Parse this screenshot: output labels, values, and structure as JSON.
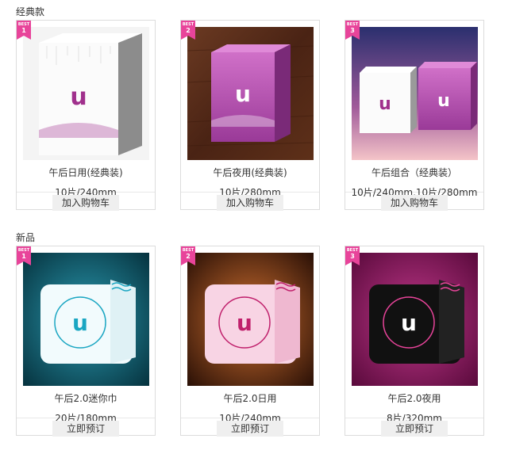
{
  "sections": [
    {
      "title": "经典款",
      "products": [
        {
          "badge_label": "BEST",
          "rank": "1",
          "name": "午后日用(经典装)",
          "spec": "10片/240mm",
          "action": "加入购物车",
          "bg": "#f3f3f3",
          "box": "white"
        },
        {
          "badge_label": "BEST",
          "rank": "2",
          "name": "午后夜用(经典装)",
          "spec": "10片/280mm",
          "action": "加入购物车",
          "bg": "#5a2e1c",
          "box": "purple"
        },
        {
          "badge_label": "BEST",
          "rank": "3",
          "name": "午后组合（经典装）",
          "spec": "10片/240mm,10片/280mm",
          "action": "加入购物车",
          "bg": "#6a4a90",
          "box": "combo"
        }
      ]
    },
    {
      "title": "新品",
      "products": [
        {
          "badge_label": "BEST",
          "rank": "1",
          "name": "午后2.0迷你巾",
          "spec": "20片/180mm",
          "action": "立即预订",
          "bg": "#0f5d70",
          "box": "white-pack"
        },
        {
          "badge_label": "BEST",
          "rank": "2",
          "name": "午后2.0日用",
          "spec": "10片/240mm",
          "action": "立即预订",
          "bg": "#6a2c0c",
          "box": "pink-pack"
        },
        {
          "badge_label": "BEST",
          "rank": "3",
          "name": "午后2.0夜用",
          "spec": "8片/320mm",
          "action": "立即预订",
          "bg": "#8c1a62",
          "box": "black-pack"
        }
      ]
    }
  ],
  "colors": {
    "badge": "#e8449a",
    "brand": "#b0308a"
  },
  "icons": {
    "badge": "ribbon-badge-icon",
    "logo": "u-logo-icon"
  }
}
